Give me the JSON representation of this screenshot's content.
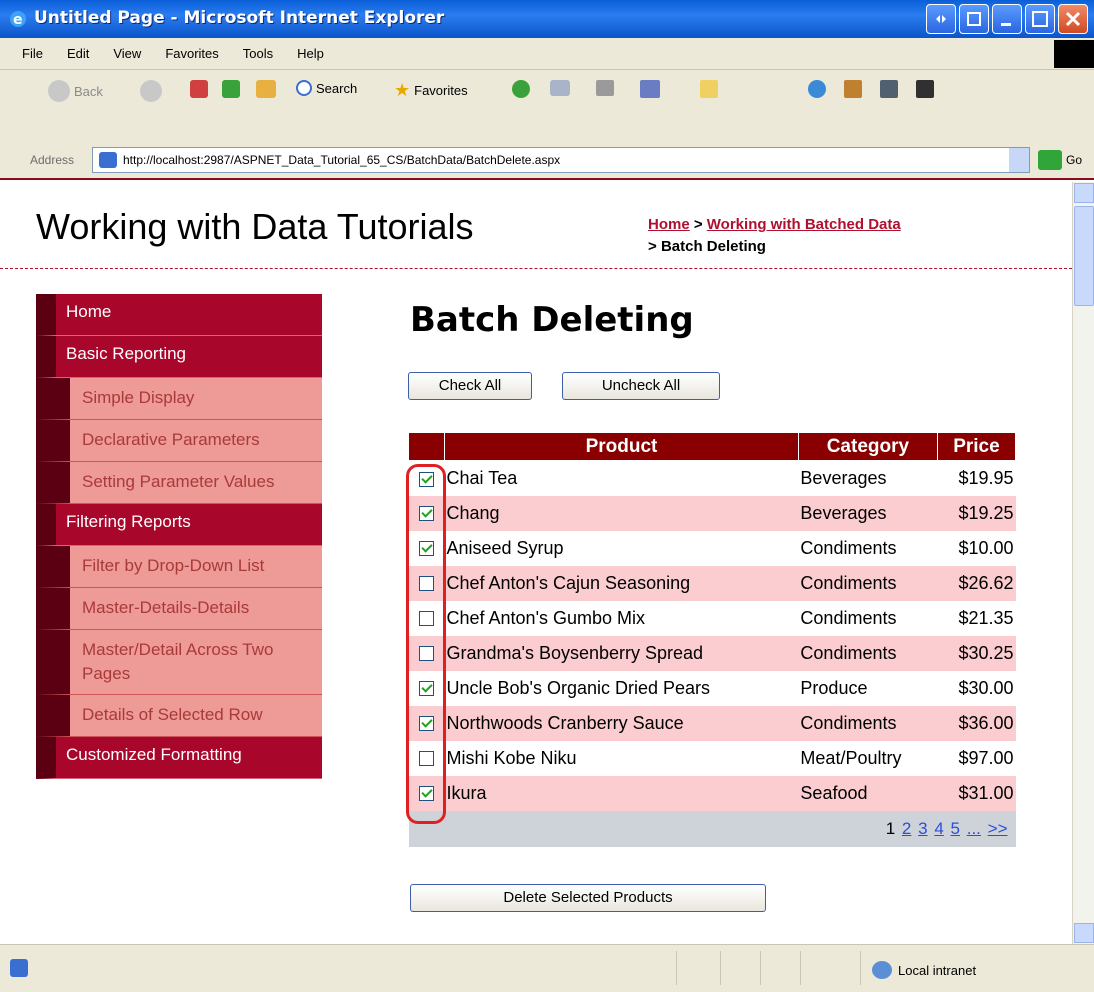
{
  "window": {
    "title": "Untitled Page - Microsoft Internet Explorer"
  },
  "menubar": {
    "items": [
      "File",
      "Edit",
      "View",
      "Favorites",
      "Tools",
      "Help"
    ]
  },
  "toolbar": {
    "back_label": "Back",
    "search_label": "Search",
    "favorites_label": "Favorites"
  },
  "addressbar": {
    "label": "Address",
    "url": "http://localhost:2987/ASPNET_Data_Tutorial_65_CS/BatchData/BatchDelete.aspx",
    "go_label": "Go"
  },
  "page": {
    "site_title": "Working with Data Tutorials",
    "breadcrumb": {
      "home": "Home",
      "sep1": ">",
      "section": "Working with Batched Data",
      "sep2": ">",
      "current": "Batch Deleting"
    },
    "heading": "Batch Deleting",
    "check_all": "Check All",
    "uncheck_all": "Uncheck All",
    "delete_button": "Delete Selected Products"
  },
  "sidebar": {
    "items": [
      {
        "label": "Home",
        "level": "top"
      },
      {
        "label": "Basic Reporting",
        "level": "top"
      },
      {
        "label": "Simple Display",
        "level": "sub"
      },
      {
        "label": "Declarative Parameters",
        "level": "sub"
      },
      {
        "label": "Setting Parameter Values",
        "level": "sub"
      },
      {
        "label": "Filtering Reports",
        "level": "top"
      },
      {
        "label": "Filter by Drop-Down List",
        "level": "sub"
      },
      {
        "label": "Master-Details-Details",
        "level": "sub"
      },
      {
        "label": "Master/Detail Across Two Pages",
        "level": "sub"
      },
      {
        "label": "Details of Selected Row",
        "level": "sub"
      },
      {
        "label": "Customized Formatting",
        "level": "top"
      }
    ]
  },
  "grid": {
    "headers": [
      "Product",
      "Category",
      "Price"
    ],
    "rows": [
      {
        "checked": true,
        "product": "Chai Tea",
        "category": "Beverages",
        "price": "$19.95"
      },
      {
        "checked": true,
        "product": "Chang",
        "category": "Beverages",
        "price": "$19.25"
      },
      {
        "checked": true,
        "product": "Aniseed Syrup",
        "category": "Condiments",
        "price": "$10.00"
      },
      {
        "checked": false,
        "product": "Chef Anton's Cajun Seasoning",
        "category": "Condiments",
        "price": "$26.62"
      },
      {
        "checked": false,
        "product": "Chef Anton's Gumbo Mix",
        "category": "Condiments",
        "price": "$21.35"
      },
      {
        "checked": false,
        "product": "Grandma's Boysenberry Spread",
        "category": "Condiments",
        "price": "$30.25"
      },
      {
        "checked": true,
        "product": "Uncle Bob's Organic Dried Pears",
        "category": "Produce",
        "price": "$30.00"
      },
      {
        "checked": true,
        "product": "Northwoods Cranberry Sauce",
        "category": "Condiments",
        "price": "$36.00"
      },
      {
        "checked": false,
        "product": "Mishi Kobe Niku",
        "category": "Meat/Poultry",
        "price": "$97.00"
      },
      {
        "checked": true,
        "product": "Ikura",
        "category": "Seafood",
        "price": "$31.00"
      }
    ],
    "pager": {
      "current": "1",
      "pages": [
        "2",
        "3",
        "4",
        "5",
        "...",
        ">>"
      ]
    }
  },
  "statusbar": {
    "zone": "Local intranet"
  },
  "colors": {
    "accent": "#a8062a",
    "header_bg": "#8a0000",
    "alt_row": "#fbcdd0",
    "submenu_bg": "#ee9a96"
  }
}
